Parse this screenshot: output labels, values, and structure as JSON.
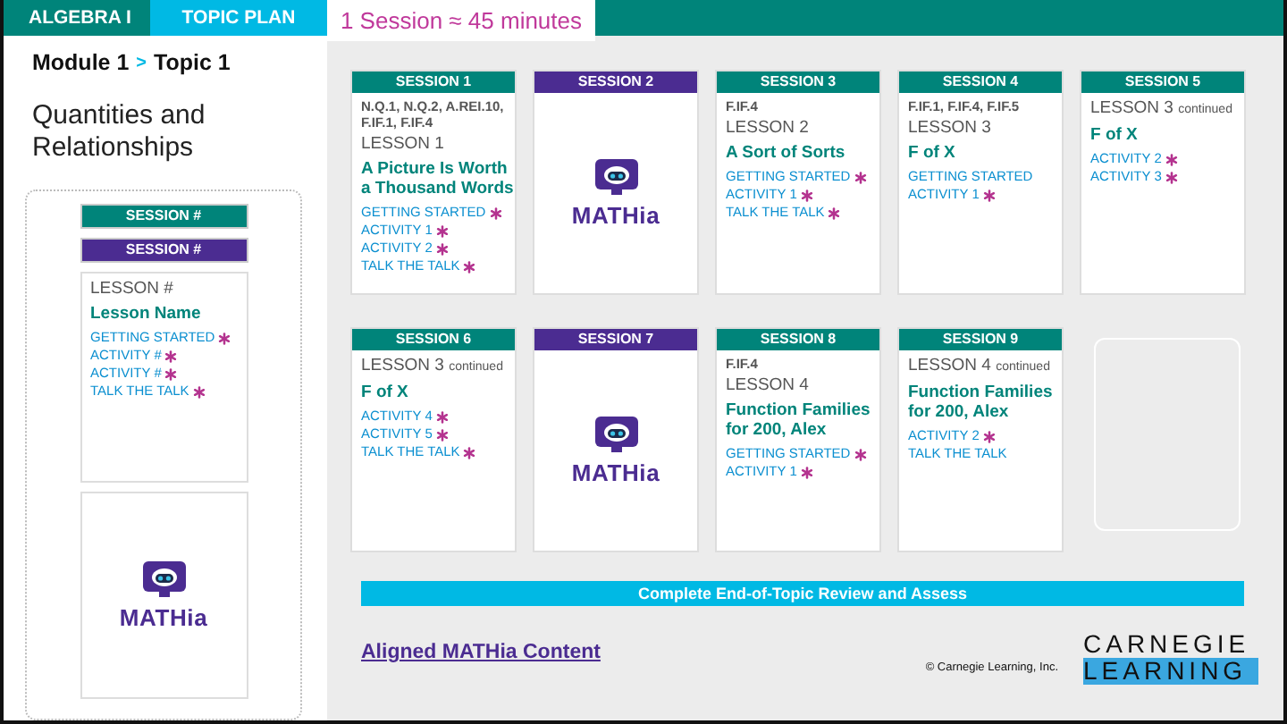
{
  "tabs": [
    {
      "label": "ALGEBRA I",
      "kind": "course"
    },
    {
      "label": "TOPIC PLAN",
      "kind": "plan"
    },
    {
      "label": "1 Session ≈ 45 minutes",
      "kind": "info"
    }
  ],
  "breadcrumb": {
    "module": "Module 1",
    "separator": ">",
    "topic": "Topic 1"
  },
  "topic_title": "Quantities and Relationships",
  "legend": {
    "headers": [
      {
        "label": "SESSION #",
        "kind": "lesson"
      },
      {
        "label": "SESSION #",
        "kind": "mathia"
      }
    ],
    "lesson_card": {
      "lesson": "LESSON #",
      "title": "Lesson Name",
      "items": [
        {
          "label": "GETTING STARTED",
          "star": true
        },
        {
          "label": "ACTIVITY #",
          "star": true
        },
        {
          "label": "ACTIVITY #",
          "star": true
        },
        {
          "label": "TALK THE TALK",
          "star": true
        }
      ]
    },
    "mathia_card": {
      "label": "MATHia"
    }
  },
  "sessions": [
    {
      "kind": "lesson",
      "header": "SESSION 1",
      "standards": "N.Q.1, N.Q.2, A.REI.10, F.IF.1, F.IF.4",
      "lesson": "LESSON 1",
      "title": "A Picture Is Worth a Thousand Words",
      "items": [
        {
          "label": "GETTING STARTED",
          "star": true
        },
        {
          "label": "ACTIVITY 1",
          "star": true
        },
        {
          "label": "ACTIVITY 2",
          "star": true
        },
        {
          "label": "TALK THE TALK",
          "star": true
        }
      ]
    },
    {
      "kind": "mathia",
      "header": "SESSION 2",
      "label": "MATHia"
    },
    {
      "kind": "lesson",
      "header": "SESSION 3",
      "standards": "F.IF.4",
      "lesson": "LESSON 2",
      "title": "A Sort of Sorts",
      "items": [
        {
          "label": "GETTING STARTED",
          "star": true
        },
        {
          "label": "ACTIVITY 1",
          "star": true
        },
        {
          "label": "TALK THE TALK",
          "star": true
        }
      ]
    },
    {
      "kind": "lesson",
      "header": "SESSION 4",
      "standards": "F.IF.1, F.IF.4, F.IF.5",
      "lesson": "LESSON 3",
      "title": "F of X",
      "items": [
        {
          "label": "GETTING STARTED",
          "star": false
        },
        {
          "label": "ACTIVITY 1",
          "star": true
        }
      ]
    },
    {
      "kind": "lesson",
      "header": "SESSION 5",
      "lesson": "LESSON 3",
      "continued": "continued",
      "title": "F of X",
      "items": [
        {
          "label": "ACTIVITY 2",
          "star": true
        },
        {
          "label": "ACTIVITY 3",
          "star": true
        }
      ]
    },
    {
      "kind": "lesson",
      "header": "SESSION 6",
      "lesson": "LESSON 3",
      "continued": "continued",
      "title": "F of X",
      "items": [
        {
          "label": "ACTIVITY 4",
          "star": true
        },
        {
          "label": "ACTIVITY 5",
          "star": true
        },
        {
          "label": "TALK THE TALK",
          "star": true
        }
      ]
    },
    {
      "kind": "mathia",
      "header": "SESSION 7",
      "label": "MATHia"
    },
    {
      "kind": "lesson",
      "header": "SESSION 8",
      "standards": "F.IF.4",
      "lesson": "LESSON 4",
      "title": "Function Families for 200, Alex",
      "items": [
        {
          "label": "GETTING STARTED",
          "star": true
        },
        {
          "label": "ACTIVITY 1",
          "star": true
        }
      ]
    },
    {
      "kind": "lesson",
      "header": "SESSION 9",
      "lesson": "LESSON 4",
      "continued": "continued",
      "title": "Function Families for 200, Alex",
      "items": [
        {
          "label": "ACTIVITY 2",
          "star": true
        },
        {
          "label": "TALK THE TALK",
          "star": false
        }
      ]
    },
    {
      "kind": "empty"
    }
  ],
  "review_bar": "Complete End-of-Topic Review and Assess",
  "footer": {
    "link": "Aligned MATHia Content",
    "copyright": "© Carnegie Learning, Inc.",
    "logo_top": "CARNEGIE",
    "logo_bottom": "LEARNING"
  }
}
